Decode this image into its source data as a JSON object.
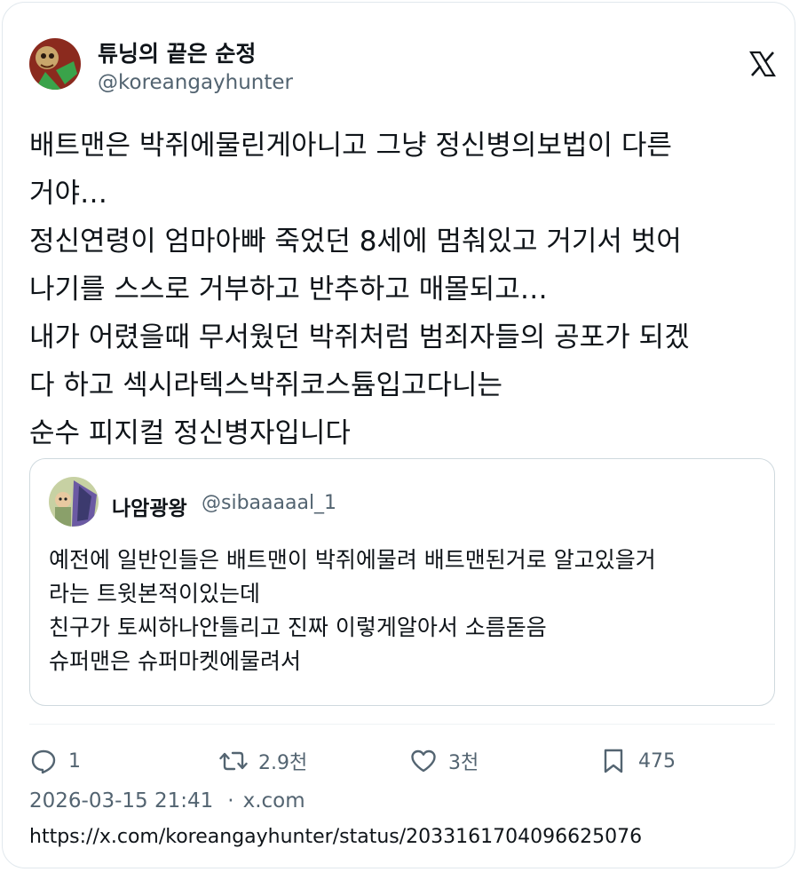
{
  "author": {
    "name": "튜닝의 끝은 순정",
    "handle": "@koreangayhunter"
  },
  "icons": {
    "brand": "x-logo-icon",
    "reply": "reply-icon",
    "retweet": "retweet-icon",
    "like": "heart-icon",
    "bookmark": "bookmark-icon"
  },
  "tweet": {
    "lines": [
      "배트맨은 박쥐에물린게아니고 그냥 정신병의보법이 다른",
      "거야…",
      "정신연령이 엄마아빠 죽었던 8세에 멈춰있고 거기서 벗어",
      "나기를 스스로 거부하고 반추하고 매몰되고…",
      "내가 어렸을때 무서웠던 박쥐처럼 범죄자들의 공포가 되겠",
      "다 하고 섹시라텍스박쥐코스튬입고다니는",
      "순수 피지컬 정신병자입니다"
    ]
  },
  "quote": {
    "name": "나암광왕",
    "handle": "@sibaaaaal_1",
    "lines": [
      "예전에 일반인들은 배트맨이 박쥐에물려 배트맨된거로 알고있을거",
      "라는 트윗본적이있는데",
      "친구가 토씨하나안틀리고 진짜 이렇게알아서 소름돋음",
      "슈퍼맨은 슈퍼마켓에물려서"
    ]
  },
  "actions": {
    "replies": "1",
    "retweets": "2.9천",
    "likes": "3천",
    "bookmarks": "475"
  },
  "meta": {
    "timestamp": "2026-03-15 21:41",
    "separator": "·",
    "source": "x.com"
  },
  "url": "https://x.com/koreangayhunter/status/2033161704096625076",
  "colors": {
    "text_primary": "#0f1419",
    "text_secondary": "#536471",
    "border": "#cfd9de"
  }
}
